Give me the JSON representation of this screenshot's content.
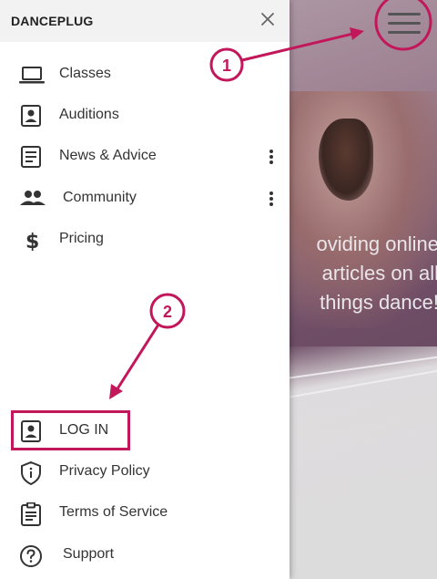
{
  "app": {
    "brand": "DANCEPLUG"
  },
  "menu": {
    "top_items": [
      {
        "label": "Classes",
        "icon": "laptop-icon"
      },
      {
        "label": "Auditions",
        "icon": "account-box-icon"
      },
      {
        "label": "News & Advice",
        "icon": "article-icon",
        "has_more": true
      },
      {
        "label": "Community",
        "icon": "people-icon",
        "has_more": true
      },
      {
        "label": "Pricing",
        "icon": "dollar-icon"
      }
    ],
    "bottom_items": [
      {
        "label": "LOG IN",
        "icon": "account-box-icon",
        "highlighted": true
      },
      {
        "label": "Privacy Policy",
        "icon": "shield-icon"
      },
      {
        "label": "Terms of Service",
        "icon": "clipboard-icon"
      },
      {
        "label": "Support",
        "icon": "help-circle-icon"
      }
    ]
  },
  "background": {
    "hero_text": [
      "oviding online",
      "articles on all",
      "things dance!"
    ]
  },
  "annotations": [
    {
      "number": "1"
    },
    {
      "number": "2"
    }
  ],
  "colors": {
    "accent": "#c2185b",
    "drawer_header": "#f2f2f2",
    "icon": "#333333"
  }
}
